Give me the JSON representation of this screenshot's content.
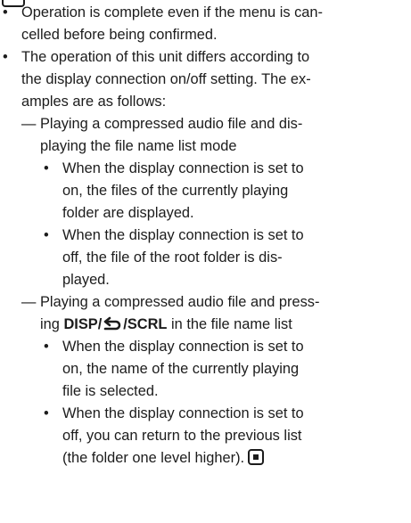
{
  "bullets": {
    "symbol": "•",
    "dash": "—"
  },
  "p1": {
    "l1": "Operation is complete even if the menu is can-",
    "l2": "celled before being confirmed."
  },
  "p2": {
    "l1": "The operation of this unit differs according to",
    "l2": "the display connection on/off setting. The ex-",
    "l3": "amples are as follows:"
  },
  "d1": {
    "l1": "Playing a compressed audio file and dis-",
    "l2": "playing the file name list mode"
  },
  "d1b1": {
    "l1": "When the display connection is set to",
    "l2": "on, the files of the currently playing",
    "l3": "folder are displayed."
  },
  "d1b2": {
    "l1": "When the display connection is set to",
    "l2": "off, the file of the root folder is dis-",
    "l3": "played."
  },
  "d2": {
    "l1": "Playing a compressed audio file and press-",
    "l2_pre": "ing ",
    "l2_disp": "DISP",
    "l2_slash1": "/",
    "l2_slash2": "/",
    "l2_scrl": "SCRL",
    "l2_post": " in the file name list"
  },
  "d2b1": {
    "l1": "When the display connection is set to",
    "l2": "on, the name of the currently playing",
    "l3": "file is selected."
  },
  "d2b2": {
    "l1": "When the display connection is set to",
    "l2": "off, you can return to the previous list",
    "l3": "(the folder one level higher)."
  }
}
